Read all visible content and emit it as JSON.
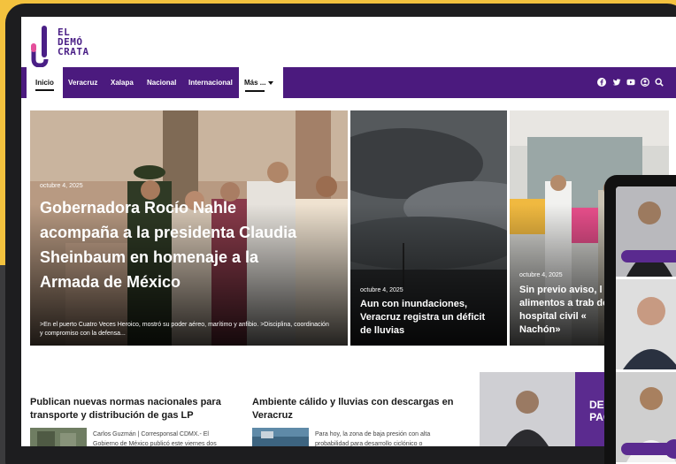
{
  "logo": {
    "line1": "EL",
    "line2": "DEMÓ",
    "line3": "CRATA"
  },
  "nav": {
    "items": [
      "Inicio",
      "Veracruz",
      "Xalapa",
      "Nacional",
      "Internacional"
    ],
    "more": "Más ...",
    "icons": [
      "facebook-icon",
      "twitter-icon",
      "youtube-icon",
      "user-icon",
      "search-icon"
    ]
  },
  "hero_main": {
    "date": "octubre 4, 2025",
    "headline": "Gobernadora Rocío Nahle acompaña a la presidenta Claudia Sheinbaum en homenaje a la Armada de México",
    "excerpt": ">En el puerto Cuatro Veces Heroico, mostró su poder aéreo, marítimo y anfibio. >Disciplina, coordinación y compromiso con la defensa..."
  },
  "hero_mid": {
    "date": "octubre 4, 2025",
    "headline": "Aun con inundaciones, Veracruz registra un déficit de lluvias"
  },
  "hero_right": {
    "date": "octubre 4, 2025",
    "headline": "Sin previo aviso, l alimentos a trab del hospital civil « Nachón»"
  },
  "articles": [
    {
      "title": "Publican nuevas normas nacionales para transporte y distribución de gas LP",
      "text": "Carlos Guzmán | Corresponsal CDMX.- El Gobierno de México publicó este viernes dos"
    },
    {
      "title": "Ambiente cálido y lluvias con descargas en Veracruz",
      "text": "Para hoy, la zona de baja presión con alta probabilidad para desarrollo ciclónico o"
    }
  ],
  "ad": {
    "line1": "DEBO",
    "line2": "PAGO"
  },
  "colors": {
    "brand": "#4b1a7e",
    "accent": "#f3c23e"
  }
}
